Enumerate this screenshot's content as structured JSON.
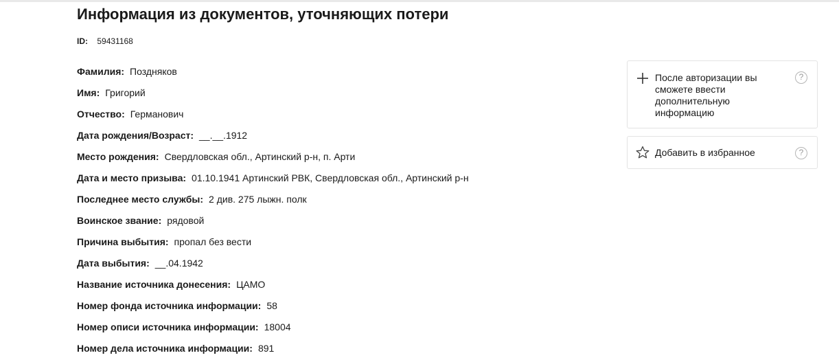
{
  "page": {
    "title": "Информация из документов, уточняющих потери",
    "id_label": "ID:",
    "id_value": "59431168"
  },
  "fields": [
    {
      "label": "Фамилия:",
      "value": "Поздняков"
    },
    {
      "label": "Имя:",
      "value": "Григорий"
    },
    {
      "label": "Отчество:",
      "value": "Германович"
    },
    {
      "label": "Дата рождения/Возраст:",
      "value": "__.__.1912"
    },
    {
      "label": "Место рождения:",
      "value": "Свердловская обл., Артинский р-н, п. Арти"
    },
    {
      "label": "Дата и место призыва:",
      "value": "01.10.1941 Артинский РВК, Свердловская обл., Артинский р-н"
    },
    {
      "label": "Последнее место службы:",
      "value": "2 див. 275 лыжн. полк"
    },
    {
      "label": "Воинское звание:",
      "value": "рядовой"
    },
    {
      "label": "Причина выбытия:",
      "value": "пропал без вести"
    },
    {
      "label": "Дата выбытия:",
      "value": "__.04.1942"
    },
    {
      "label": "Название источника донесения:",
      "value": "ЦАМО"
    },
    {
      "label": "Номер фонда источника информации:",
      "value": "58"
    },
    {
      "label": "Номер описи источника информации:",
      "value": "18004"
    },
    {
      "label": "Номер дела источника информации:",
      "value": "891"
    }
  ],
  "sidebar": {
    "auth_card": {
      "text": "После авторизации вы сможете ввести дополнительную информацию",
      "icon": "plus-icon",
      "help_icon": "question-icon",
      "help_glyph": "?"
    },
    "favorite_card": {
      "text": "Добавить в избранное",
      "icon": "star-icon",
      "help_icon": "question-icon",
      "help_glyph": "?"
    }
  }
}
